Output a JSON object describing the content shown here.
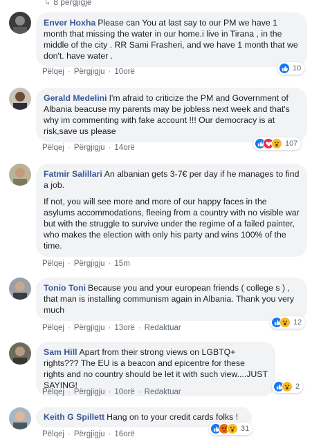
{
  "top_replies": {
    "text": "8 përgjigje"
  },
  "comments": [
    {
      "author": "Enver Hoxha",
      "paragraphs": [
        "Please can You at last say to our PM we have 1 month that missing the water in our home.i live in Tirana , in the middle of the city . RR Sami Frasheri, and we have 1 month that we don't. have water ."
      ],
      "like": "Pëlqej",
      "reply": "Përgjigju",
      "time": "10orë",
      "edited": "",
      "reactions": [
        "like"
      ],
      "count": "10"
    },
    {
      "author": "Gerald Medelini",
      "paragraphs": [
        "I'm afraid to criticize the PM and Government of Albania beacuse my parents may be jobless next week and that's why im commenting with fake account !!! Our democracy is at risk,save us please"
      ],
      "like": "Pëlqej",
      "reply": "Përgjigju",
      "time": "14orë",
      "edited": "",
      "reactions": [
        "like",
        "love",
        "wow"
      ],
      "count": "107"
    },
    {
      "author": "Fatmir Salillari",
      "paragraphs": [
        "An albanian gets 3-7€ per day if he manages to find a job.",
        "If not, you will see more and more of our happy faces in the asylums accommodations, fleeing from a country with no visible war but with the struggle to survive under the regime of a failed painter, who makes the election with only his party and wins 100% of the time."
      ],
      "like": "Pëlqej",
      "reply": "Përgjigju",
      "time": "15m",
      "edited": "",
      "reactions": [],
      "count": ""
    },
    {
      "author": "Tonio Toni",
      "paragraphs": [
        "Because you and your european friends ( college s ) , that man is installing communism again in Albania. Thank you very much"
      ],
      "like": "Pëlqej",
      "reply": "Përgjigju",
      "time": "13orë",
      "edited": "Redaktuar",
      "reactions": [
        "like",
        "wow"
      ],
      "count": "12"
    },
    {
      "author": "Sam Hill",
      "paragraphs": [
        "Apart from their strong views on LGBTQ+ rights??? The EU is a beacon and epicentre for these rights and no country should be let it with such view....JUST SAYING!"
      ],
      "like": "Pëlqej",
      "reply": "Përgjigju",
      "time": "10orë",
      "edited": "Redaktuar",
      "reactions": [
        "like",
        "wow"
      ],
      "count": "2"
    },
    {
      "author": "Keith G Spillett",
      "paragraphs": [
        "Hang on to your credit cards folks !"
      ],
      "like": "Pëlqej",
      "reply": "Përgjigju",
      "time": "16orë",
      "edited": "",
      "reactions": [
        "like",
        "angry",
        "wow"
      ],
      "count": "31"
    }
  ],
  "colors": {
    "author": "#385898",
    "bubble": "#f2f3f5",
    "like": "#1877f2",
    "love": "#f0284a",
    "wow": "#f7b928",
    "angry": "#e9710f"
  }
}
